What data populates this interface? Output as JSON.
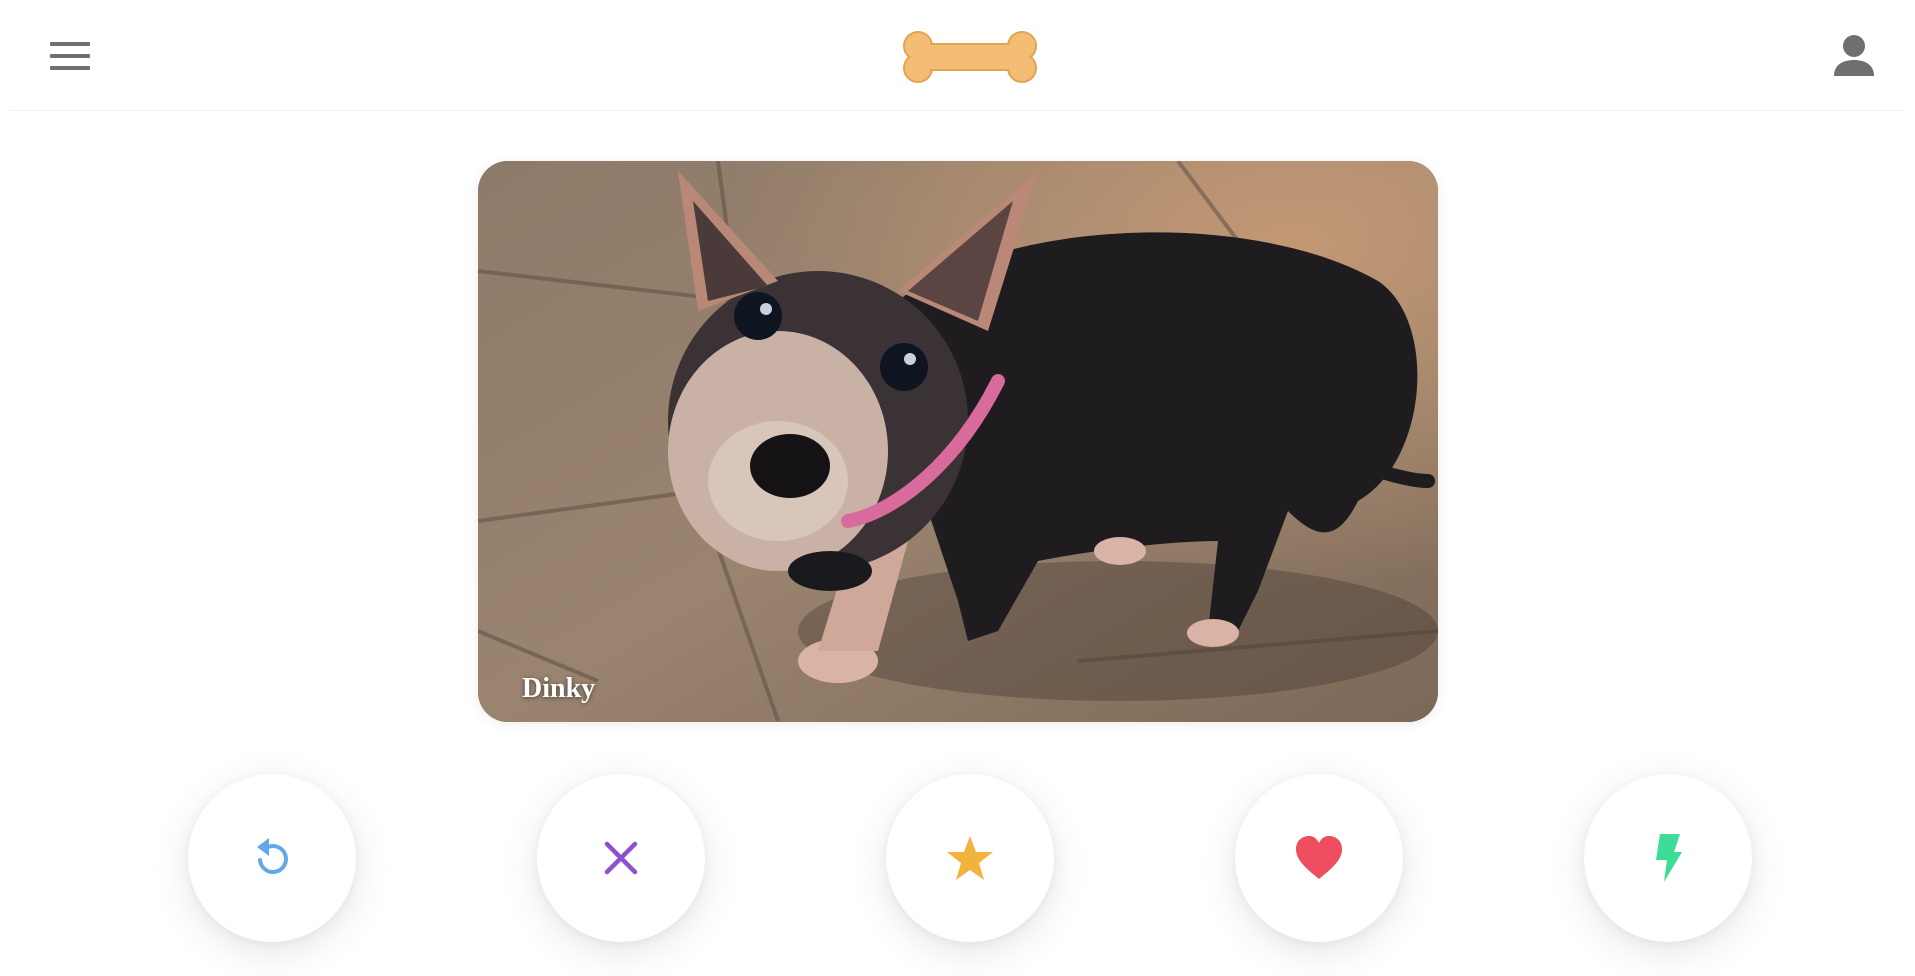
{
  "header": {
    "menu_icon": "hamburger-menu-icon",
    "logo_icon": "bone-logo",
    "profile_icon": "person-icon",
    "logo_color": "#F3BE74",
    "icon_color": "#6f6f6f"
  },
  "card": {
    "pet_name": "Dinky",
    "photo": "dog-photo"
  },
  "actions": [
    {
      "name": "rewind",
      "icon": "undo-icon",
      "color": "#63A9E8"
    },
    {
      "name": "nope",
      "icon": "close-icon",
      "color": "#8E4FD0"
    },
    {
      "name": "super-like",
      "icon": "star-icon",
      "color": "#F2B33D"
    },
    {
      "name": "like",
      "icon": "heart-icon",
      "color": "#EE4E5F"
    },
    {
      "name": "boost",
      "icon": "lightning-icon",
      "color": "#3DDC97"
    }
  ]
}
